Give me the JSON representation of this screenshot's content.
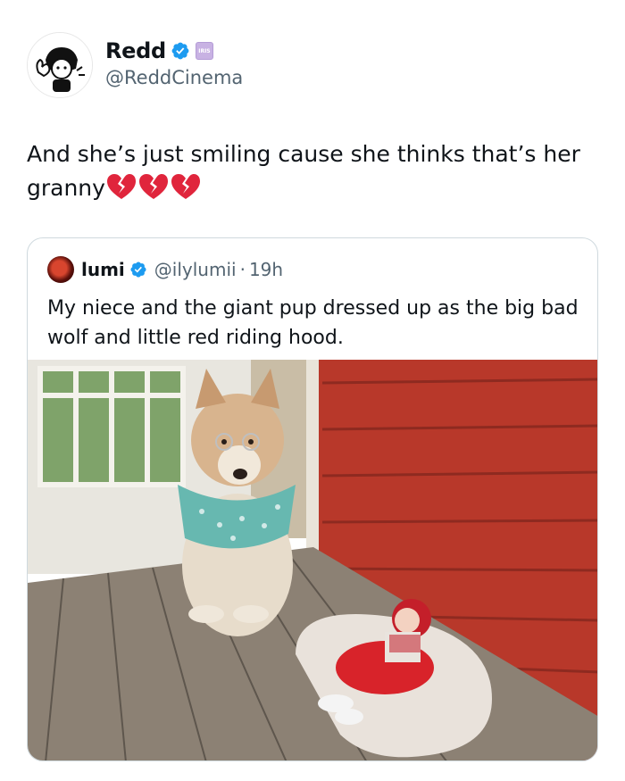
{
  "author": {
    "display_name": "Redd",
    "handle": "@ReddCinema",
    "verified_icon": "verified-check-icon",
    "affiliate_badge": "iris-badge"
  },
  "tweet": {
    "text": "And she’s just smiling cause she thinks that’s her granny",
    "emoji": [
      "broken-heart",
      "broken-heart",
      "broken-heart"
    ]
  },
  "quoted": {
    "display_name": "lumi",
    "handle": "@ilylumii",
    "separator": "·",
    "time": "19h",
    "text": "My niece and the giant pup dressed up as the big bad wolf and little red riding hood.",
    "photo_desc_icon": "photo-dog-baby"
  },
  "colors": {
    "verified_blue": "#1d9bf0",
    "heart_red": "#e0253c",
    "barn_red": "#b8382a"
  }
}
